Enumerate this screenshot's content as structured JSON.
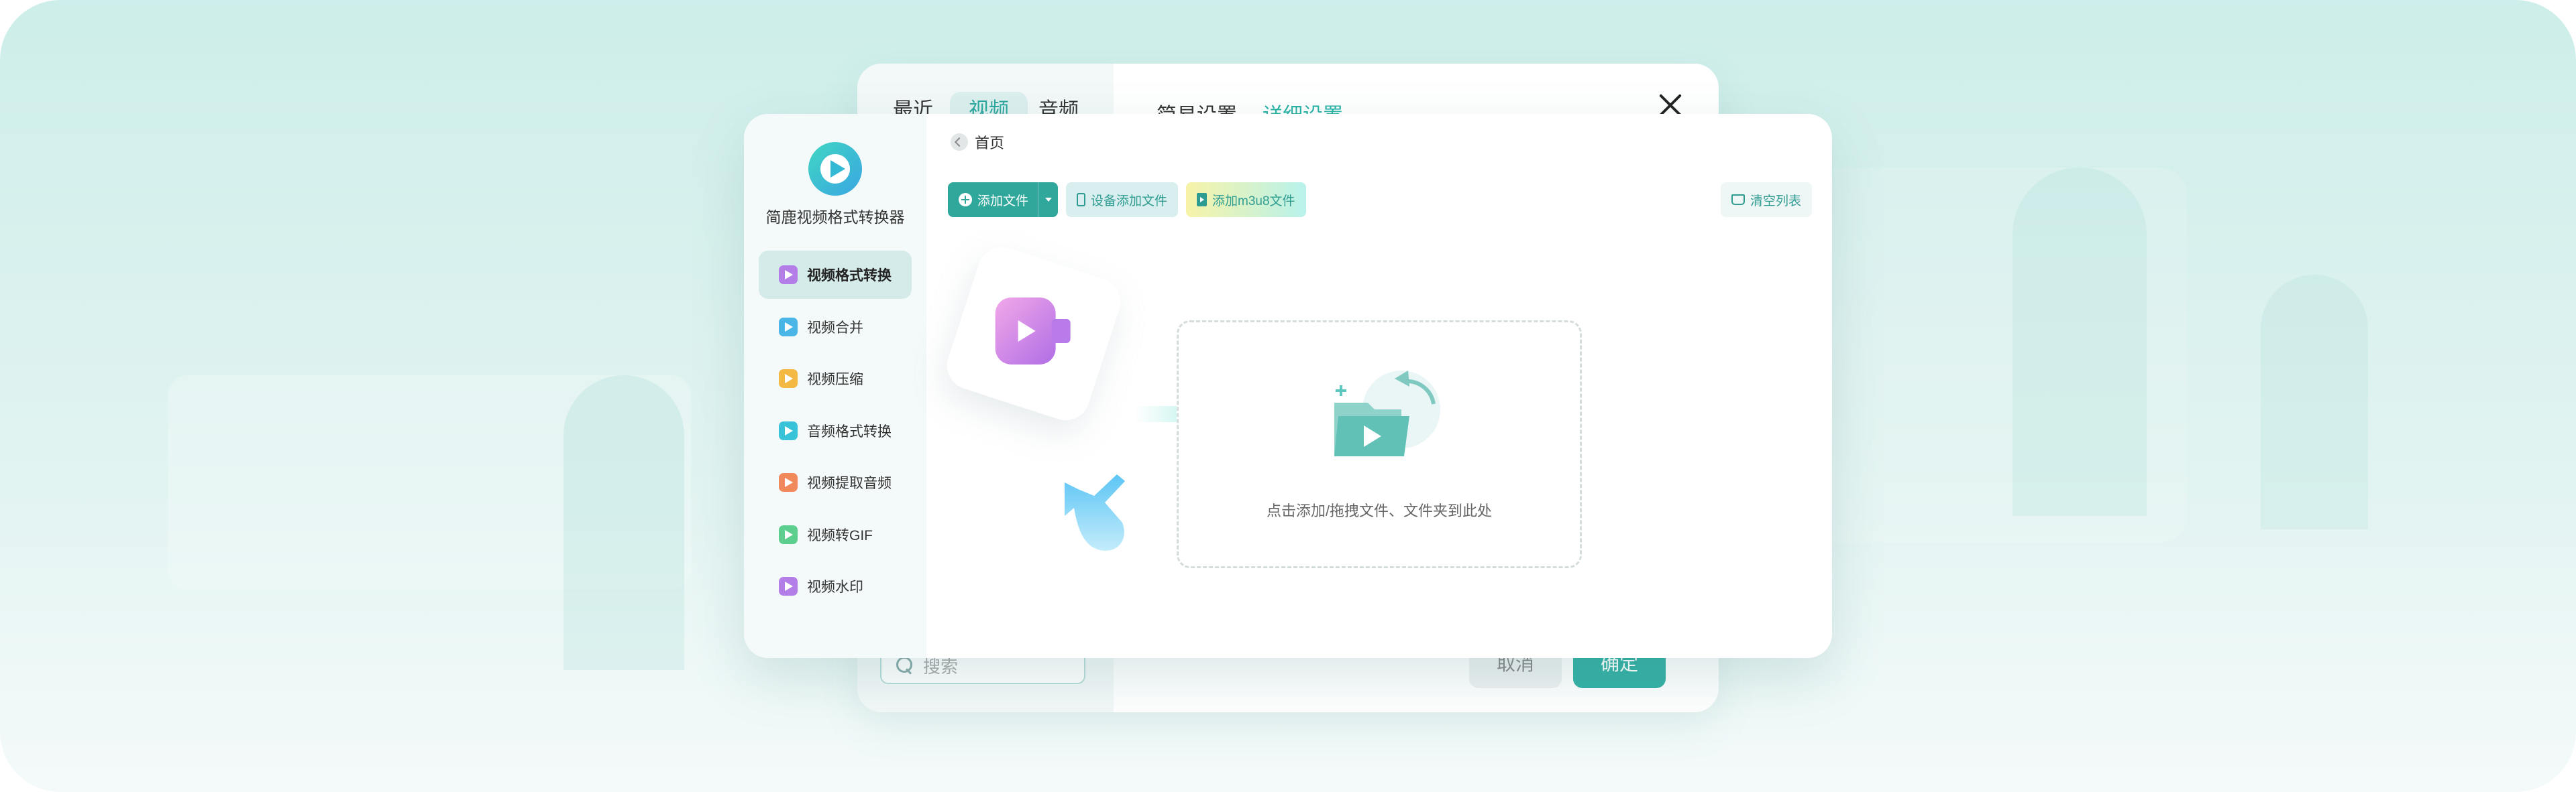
{
  "back_window": {
    "tabs": [
      "最近",
      "视频",
      "音频"
    ],
    "settings_tabs": [
      "简易设置",
      "详细设置"
    ],
    "search_placeholder": "搜索",
    "cancel_label": "取消",
    "confirm_label": "确定"
  },
  "app": {
    "name": "简鹿视频格式转换器",
    "logo_icon": "play-circle-icon",
    "brand_color": "#2fa79a"
  },
  "sidebar": {
    "items": [
      {
        "label": "视频格式转换",
        "icon": "video-convert-icon",
        "color": "#b47ee8",
        "active": true
      },
      {
        "label": "视频合并",
        "icon": "video-merge-icon",
        "color": "#4ab6e8",
        "active": false
      },
      {
        "label": "视频压缩",
        "icon": "video-compress-icon",
        "color": "#f4b942",
        "active": false
      },
      {
        "label": "音频格式转换",
        "icon": "audio-convert-icon",
        "color": "#39c3d9",
        "active": false
      },
      {
        "label": "视频提取音频",
        "icon": "extract-audio-icon",
        "color": "#f08a5d",
        "active": false
      },
      {
        "label": "视频转GIF",
        "icon": "gif-icon",
        "color": "#5ccf8f",
        "active": false
      },
      {
        "label": "视频水印",
        "icon": "watermark-icon",
        "color": "#b47ee8",
        "active": false
      }
    ]
  },
  "breadcrumb": {
    "label": "首页",
    "icon": "back-arrow-icon"
  },
  "toolbar": {
    "add_file": "添加文件",
    "device_add": "设备添加文件",
    "add_m3u8": "添加m3u8文件",
    "clear_list": "清空列表"
  },
  "dropzone": {
    "text": "点击添加/拖拽文件、文件夹到此处"
  }
}
